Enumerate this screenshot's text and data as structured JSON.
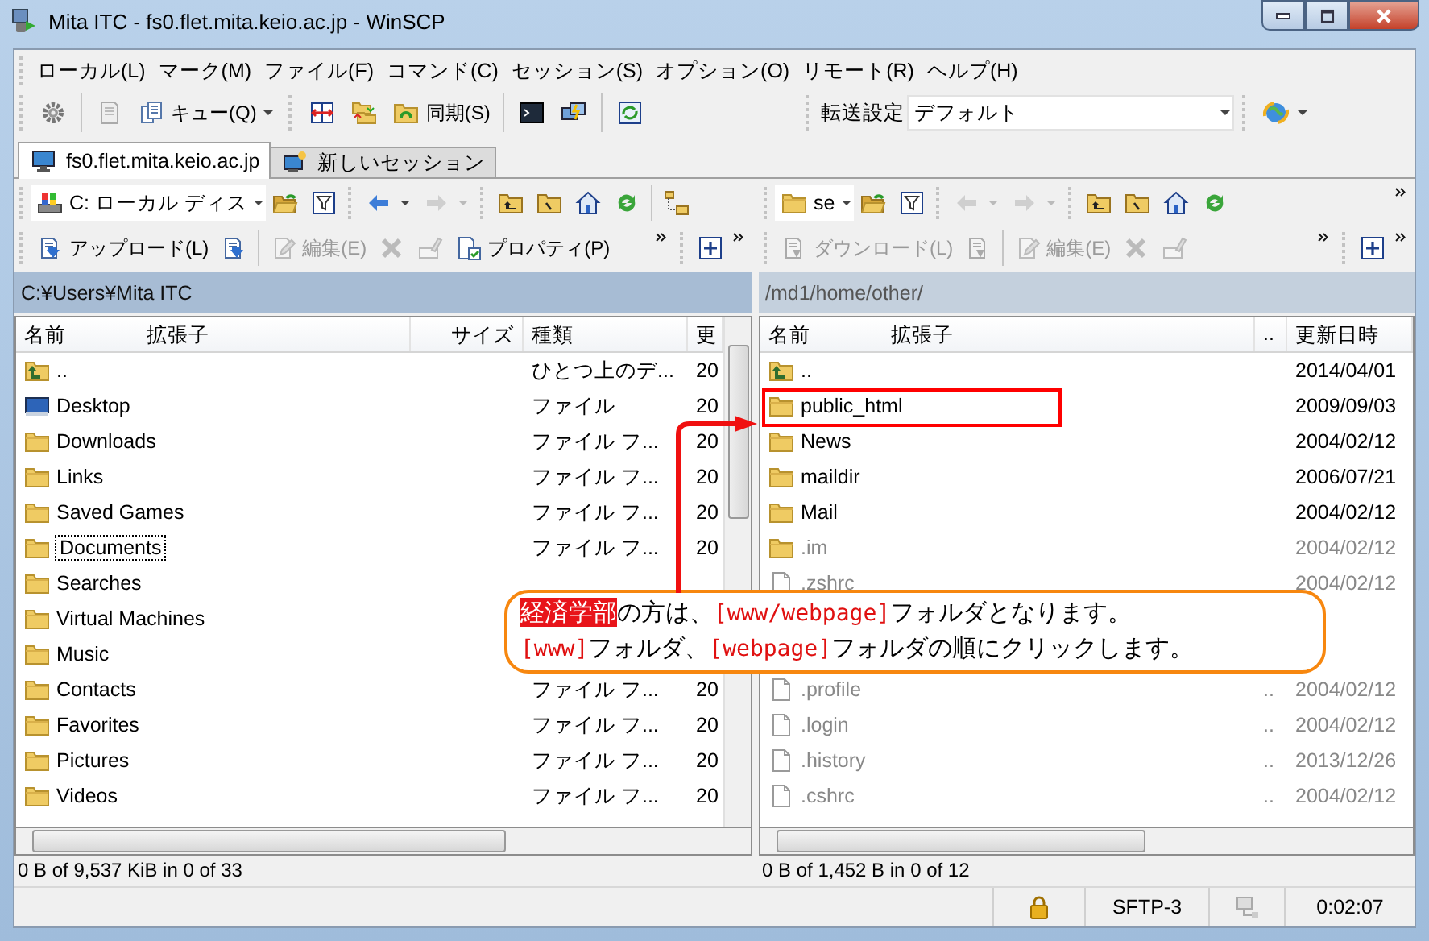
{
  "window": {
    "title": "Mita ITC - fs0.flet.mita.keio.ac.jp - WinSCP"
  },
  "menu": [
    "ローカル(L)",
    "マーク(M)",
    "ファイル(F)",
    "コマンド(C)",
    "セッション(S)",
    "オプション(O)",
    "リモート(R)",
    "ヘルプ(H)"
  ],
  "toolbar": {
    "queue_label": "キュー(Q)",
    "sync_label": "同期(S)",
    "transfer_label": "転送設定",
    "transfer_value": "デフォルト"
  },
  "tabs": [
    {
      "label": "fs0.flet.mita.keio.ac.jp",
      "selected": true
    },
    {
      "label": "新しいセッション",
      "selected": false
    }
  ],
  "panels": [
    {
      "kind": "local",
      "active": true,
      "drive": "C: ローカル ディス",
      "commands": [
        {
          "label": "アップロード(L)",
          "disabled": false
        },
        {
          "label": "編集(E)",
          "disabled": true
        },
        {
          "label": "プロパティ(P)",
          "disabled": false
        }
      ],
      "path": "C:¥Users¥Mita ITC",
      "columns": [
        "名前",
        "拡張子",
        "サイズ",
        "種類",
        "更"
      ],
      "rows": [
        {
          "kind": "parent",
          "name": "..",
          "type": "ひとつ上のデ...",
          "date": "20"
        },
        {
          "kind": "desktop",
          "name": "Desktop",
          "type": "ファイル",
          "date": "20"
        },
        {
          "kind": "folder",
          "name": "Downloads",
          "type": "ファイル フ...",
          "date": "20"
        },
        {
          "kind": "folder",
          "name": "Links",
          "type": "ファイル フ...",
          "date": "20"
        },
        {
          "kind": "folder",
          "name": "Saved Games",
          "type": "ファイル フ...",
          "date": "20"
        },
        {
          "kind": "folder",
          "name": "Documents",
          "type": "ファイル フ...",
          "date": "20",
          "focused": true
        },
        {
          "kind": "folder",
          "name": "Searches"
        },
        {
          "kind": "folder",
          "name": "Virtual Machines"
        },
        {
          "kind": "folder",
          "name": "Music"
        },
        {
          "kind": "folder",
          "name": "Contacts",
          "type": "ファイル フ...",
          "date": "20"
        },
        {
          "kind": "folder",
          "name": "Favorites",
          "type": "ファイル フ...",
          "date": "20"
        },
        {
          "kind": "folder",
          "name": "Pictures",
          "type": "ファイル フ...",
          "date": "20"
        },
        {
          "kind": "folder",
          "name": "Videos",
          "type": "ファイル フ...",
          "date": "20"
        }
      ],
      "status": "0 B of 9,537 KiB in 0 of 33"
    },
    {
      "kind": "remote",
      "active": false,
      "drive": "se",
      "commands": [
        {
          "label": "ダウンロード(L)",
          "disabled": true
        },
        {
          "label": "編集(E)",
          "disabled": true
        }
      ],
      "path": "/md1/home/other/",
      "columns": [
        "名前",
        "拡張子",
        "..",
        "更新日時"
      ],
      "rows": [
        {
          "kind": "parent",
          "name": "..",
          "date": "2014/04/01"
        },
        {
          "kind": "folder",
          "name": "public_html",
          "date": "2009/09/03",
          "highlighted": true
        },
        {
          "kind": "folder",
          "name": "News",
          "date": "2004/02/12"
        },
        {
          "kind": "folder",
          "name": "maildir",
          "date": "2006/07/21"
        },
        {
          "kind": "folder",
          "name": "Mail",
          "date": "2004/02/12"
        },
        {
          "kind": "folder",
          "name": ".im",
          "date": "2004/02/12",
          "dimmed": true
        },
        {
          "kind": "file",
          "name": ".zshrc",
          "date": "2004/02/12",
          "dimmed": true
        },
        {
          "kind": "blank"
        },
        {
          "kind": "blank"
        },
        {
          "kind": "file",
          "name": ".profile",
          "attr": "..",
          "date": "2004/02/12",
          "dimmed": true
        },
        {
          "kind": "file",
          "name": ".login",
          "attr": "..",
          "date": "2004/02/12",
          "dimmed": true
        },
        {
          "kind": "file",
          "name": ".history",
          "attr": "..",
          "date": "2013/12/26",
          "dimmed": true
        },
        {
          "kind": "file",
          "name": ".cshrc",
          "attr": "..",
          "date": "2004/02/12",
          "dimmed": true
        }
      ],
      "status": "0 B of 1,452 B in 0 of 12"
    }
  ],
  "status_bar": [
    "SFTP-3",
    "0:02:07"
  ],
  "callout": {
    "lines": [
      [
        {
          "kind": "highlight",
          "text": "経済学部"
        },
        {
          "kind": "plain",
          "text": "の方は、"
        },
        {
          "kind": "bracket",
          "text": "[www/webpage]"
        },
        {
          "kind": "plain",
          "text": "フォルダとなります。"
        }
      ],
      [
        {
          "kind": "bracket",
          "text": "[www]"
        },
        {
          "kind": "plain",
          "text": "フォルダ、"
        },
        {
          "kind": "bracket",
          "text": "[webpage]"
        },
        {
          "kind": "plain",
          "text": "フォルダの順にクリックします。"
        }
      ]
    ]
  }
}
